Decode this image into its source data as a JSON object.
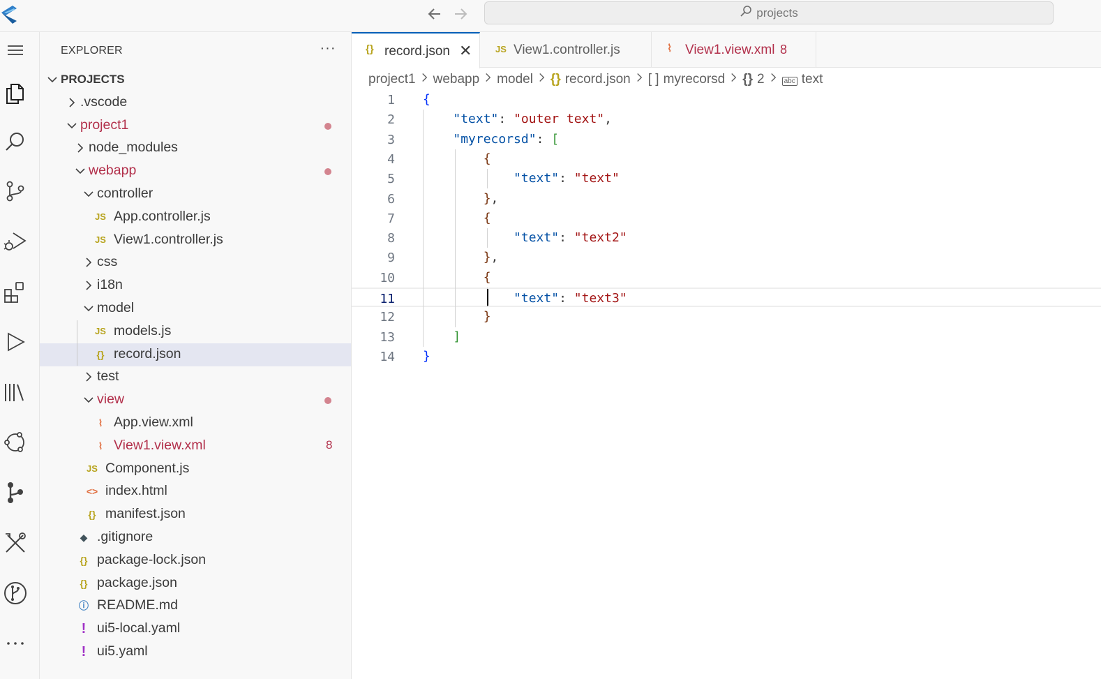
{
  "titlebar": {
    "search_text": "projects"
  },
  "activity_bar": {
    "items": [
      "menu-icon",
      "explorer-icon",
      "search-icon",
      "source-control-icon",
      "run-debug-icon",
      "extensions-icon",
      "run-icon",
      "library-icon",
      "remote-icon",
      "git-graph-icon",
      "tools-icon",
      "git-branch-icon",
      "more-icon"
    ]
  },
  "sidebar": {
    "title": "EXPLORER",
    "more": "···",
    "tree": [
      {
        "label": "PROJECTS",
        "depth": 0,
        "type": "root",
        "expanded": true
      },
      {
        "label": ".vscode",
        "depth": 1,
        "type": "folder",
        "expanded": false
      },
      {
        "label": "project1",
        "depth": 1,
        "type": "folder",
        "expanded": true,
        "modified": true
      },
      {
        "label": "node_modules",
        "depth": 2,
        "type": "folder",
        "expanded": false
      },
      {
        "label": "webapp",
        "depth": 2,
        "type": "folder",
        "expanded": true,
        "modified": true
      },
      {
        "label": "controller",
        "depth": 3,
        "type": "folder",
        "expanded": true
      },
      {
        "label": "App.controller.js",
        "depth": 4,
        "type": "js"
      },
      {
        "label": "View1.controller.js",
        "depth": 4,
        "type": "js"
      },
      {
        "label": "css",
        "depth": 3,
        "type": "folder",
        "expanded": false
      },
      {
        "label": "i18n",
        "depth": 3,
        "type": "folder",
        "expanded": false
      },
      {
        "label": "model",
        "depth": 3,
        "type": "folder",
        "expanded": true
      },
      {
        "label": "models.js",
        "depth": 4,
        "type": "js"
      },
      {
        "label": "record.json",
        "depth": 4,
        "type": "json",
        "selected": true
      },
      {
        "label": "test",
        "depth": 3,
        "type": "folder",
        "expanded": false
      },
      {
        "label": "view",
        "depth": 3,
        "type": "folder",
        "expanded": true,
        "modified": true
      },
      {
        "label": "App.view.xml",
        "depth": 4,
        "type": "xml"
      },
      {
        "label": "View1.view.xml",
        "depth": 4,
        "type": "xml",
        "modified": true,
        "count": "8"
      },
      {
        "label": "Component.js",
        "depth": 3,
        "type": "js"
      },
      {
        "label": "index.html",
        "depth": 3,
        "type": "html"
      },
      {
        "label": "manifest.json",
        "depth": 3,
        "type": "json"
      },
      {
        "label": ".gitignore",
        "depth": 2,
        "type": "git"
      },
      {
        "label": "package-lock.json",
        "depth": 2,
        "type": "json"
      },
      {
        "label": "package.json",
        "depth": 2,
        "type": "json"
      },
      {
        "label": "README.md",
        "depth": 2,
        "type": "info"
      },
      {
        "label": "ui5-local.yaml",
        "depth": 2,
        "type": "yaml"
      },
      {
        "label": "ui5.yaml",
        "depth": 2,
        "type": "yaml"
      }
    ],
    "icon_glyphs": {
      "js": "JS",
      "json": "{}",
      "xml": "⌇",
      "html": "<>",
      "git": "◆",
      "info": "ⓘ",
      "yaml": "!"
    }
  },
  "tabs": [
    {
      "icon": "{}",
      "label": "record.json",
      "active": true,
      "close": "✕"
    },
    {
      "icon": "JS",
      "label": "View1.controller.js",
      "active": false
    },
    {
      "icon": "⌇",
      "label": "View1.view.xml",
      "active": false,
      "modified": true,
      "count": "8"
    }
  ],
  "breadcrumb": [
    {
      "label": "project1"
    },
    {
      "label": "webapp"
    },
    {
      "label": "model"
    },
    {
      "icon": "{}",
      "label": "record.json"
    },
    {
      "icon": "[ ]",
      "label": "myrecorsd"
    },
    {
      "icon": "{}",
      "label": "2"
    },
    {
      "icon": "abc",
      "label": "text"
    }
  ],
  "editor": {
    "current_line": 11,
    "lines": [
      {
        "n": "1",
        "code": "{"
      },
      {
        "n": "2",
        "code": "    \"text\": \"outer text\","
      },
      {
        "n": "3",
        "code": "    \"myrecorsd\": ["
      },
      {
        "n": "4",
        "code": "        {"
      },
      {
        "n": "5",
        "code": "            \"text\": \"text\""
      },
      {
        "n": "6",
        "code": "        },"
      },
      {
        "n": "7",
        "code": "        {"
      },
      {
        "n": "8",
        "code": "            \"text\": \"text2\""
      },
      {
        "n": "9",
        "code": "        },"
      },
      {
        "n": "10",
        "code": "        {"
      },
      {
        "n": "11",
        "code": "            \"text\": \"text3\""
      },
      {
        "n": "12",
        "code": "        }"
      },
      {
        "n": "13",
        "code": "    ]"
      },
      {
        "n": "14",
        "code": "}"
      }
    ]
  },
  "colors": {
    "accent": "#005fb8",
    "modified": "#b2304b",
    "json_key": "#0451a5",
    "json_string": "#a31515",
    "selection": "#e4e6f1"
  }
}
